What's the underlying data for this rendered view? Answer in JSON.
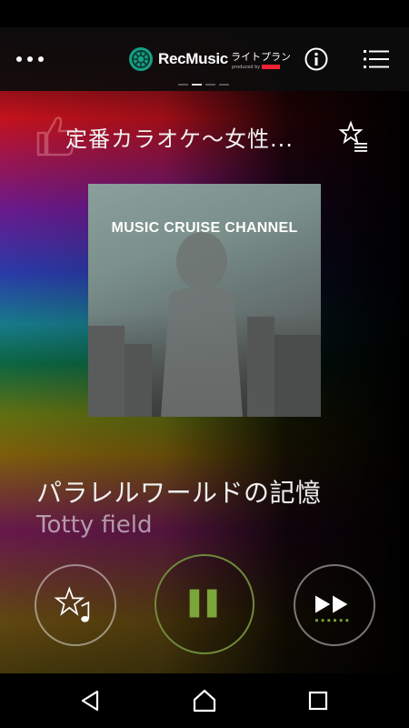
{
  "header": {
    "brand_name": "RecMusic",
    "brand_sub": "ライトプラン",
    "brand_credit": "produced by",
    "icons": [
      "more-icon",
      "info-icon",
      "list-menu-icon"
    ]
  },
  "playlist": {
    "title": "定番カラオケ〜女性..."
  },
  "artwork": {
    "label": "MUSIC CRUISE CHANNEL"
  },
  "track": {
    "title": "パラレルワールドの記憶",
    "artist": "Totty field"
  },
  "controls": {
    "favorite_icon": "star-music-icon",
    "pause_icon": "pause-icon",
    "next_icon": "fast-forward-icon",
    "accent_color": "#7aa63a"
  },
  "pager": {
    "pages": 4,
    "active_index": 1
  },
  "navbar": {
    "icons": [
      "back-icon",
      "home-icon",
      "recents-icon"
    ]
  }
}
